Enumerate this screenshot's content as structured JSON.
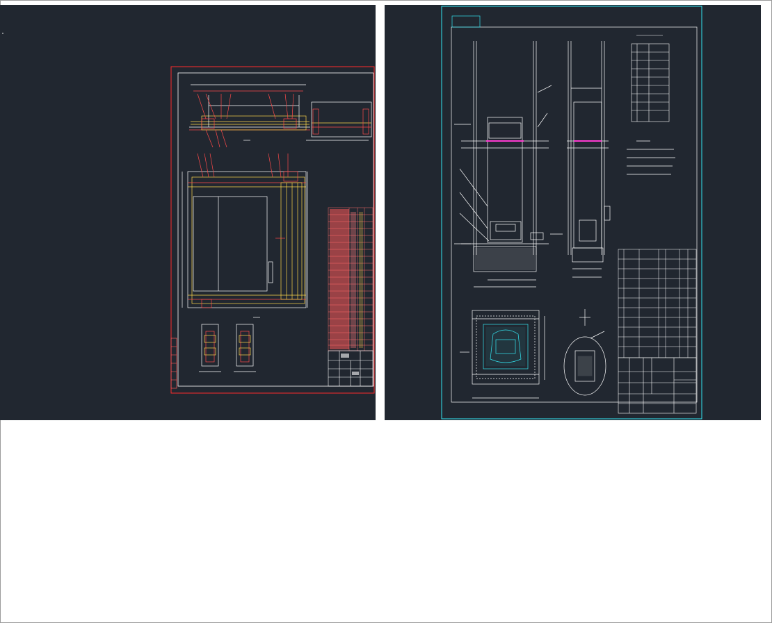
{
  "panes": {
    "left": {
      "label": "assembly-drawing-viewport",
      "stroke_colors": {
        "border": "#ff2b2b",
        "lines": "#ffffff",
        "detail": "#ffd84a",
        "table": "#ff6a6a"
      }
    },
    "right": {
      "label": "layout-drawing-viewport",
      "stroke_colors": {
        "border": "#34e6f2",
        "lines": "#ffffff",
        "accent": "#ff3bd2",
        "table": "#ffffff"
      }
    }
  }
}
